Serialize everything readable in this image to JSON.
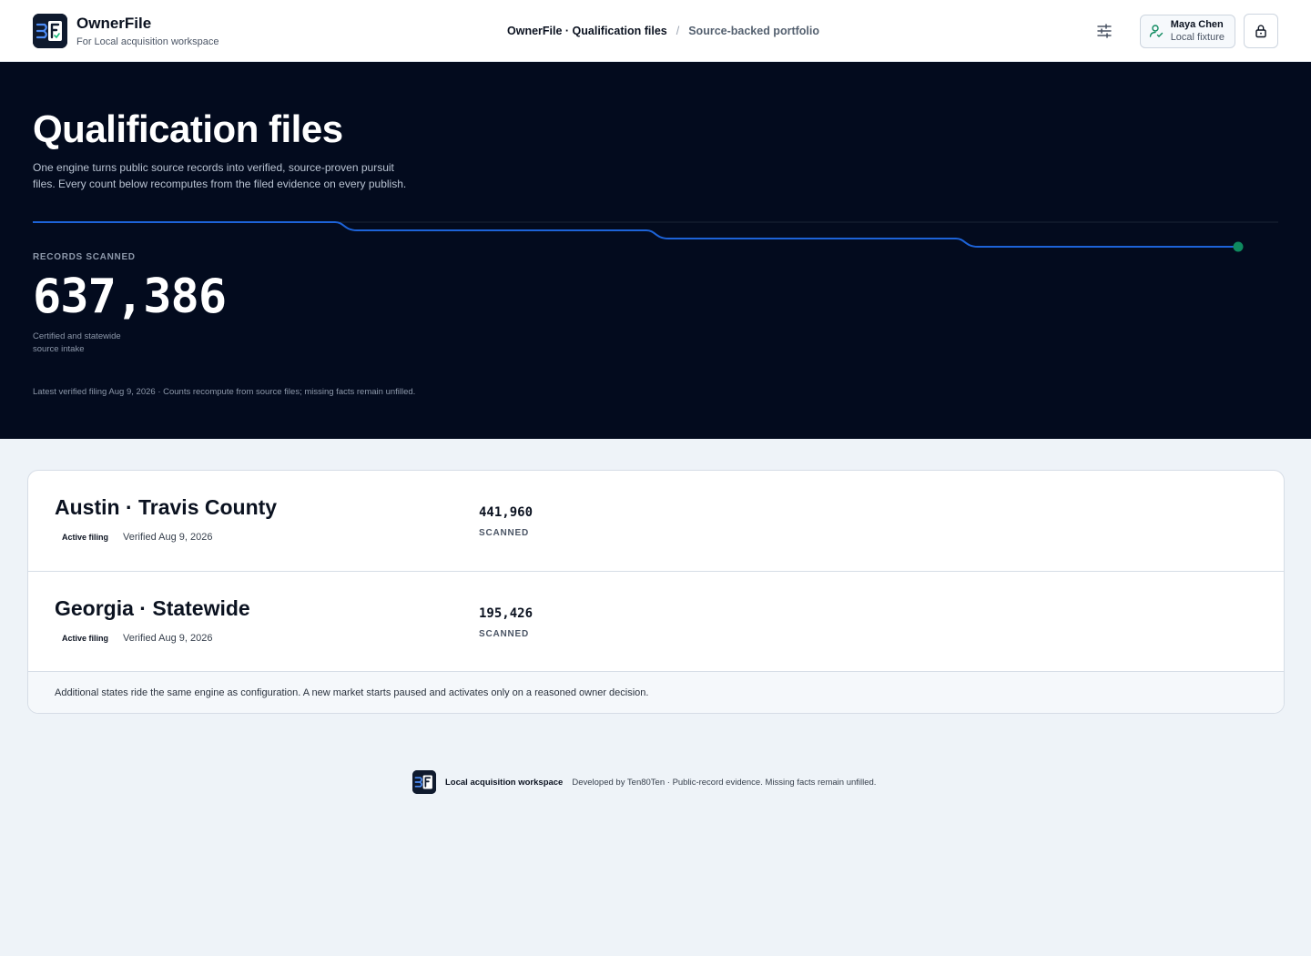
{
  "app": {
    "name": "OwnerFile",
    "workspace": "For Local acquisition workspace"
  },
  "breadcrumb": {
    "current": "OwnerFile · Qualification files",
    "separator": "/",
    "section": "Source-backed portfolio"
  },
  "user": {
    "name": "Maya Chen",
    "role": "Local fixture"
  },
  "icons": {
    "filter": "sliders-icon",
    "user": "user-check-icon",
    "lock": "lock-icon"
  },
  "hero": {
    "title": "Qualification files",
    "intro": "One engine turns public source records into verified, source-proven pursuit files. Every count below recomputes from the filed evidence on every publish.",
    "metric_label": "RECORDS SCANNED",
    "metric_value": "637,386",
    "metric_note": "Certified and statewide source intake",
    "footnote": "Latest verified filing Aug 9, 2026 · Counts recompute from source files; missing facts remain unfilled."
  },
  "markets": [
    {
      "title": "Austin · Travis County",
      "badge": "Active filing",
      "verified": "Verified Aug 9, 2026",
      "count": "441,960",
      "count_label": "SCANNED"
    },
    {
      "title": "Georgia · Statewide",
      "badge": "Active filing",
      "verified": "Verified Aug 9, 2026",
      "count": "195,426",
      "count_label": "SCANNED"
    }
  ],
  "card_note": "Additional states ride the same engine as configuration. A new market starts paused and activates only on a reasoned owner decision.",
  "footer": {
    "workspace": "Local acquisition workspace",
    "developer": "Developed by Ten80Ten · Public-record evidence. Missing facts remain unfilled."
  },
  "colors": {
    "hero_bg": "#030b1e",
    "trend_line": "#1d63d8",
    "trend_end": "#0f8a5f",
    "page_bg": "#eef3f8"
  }
}
